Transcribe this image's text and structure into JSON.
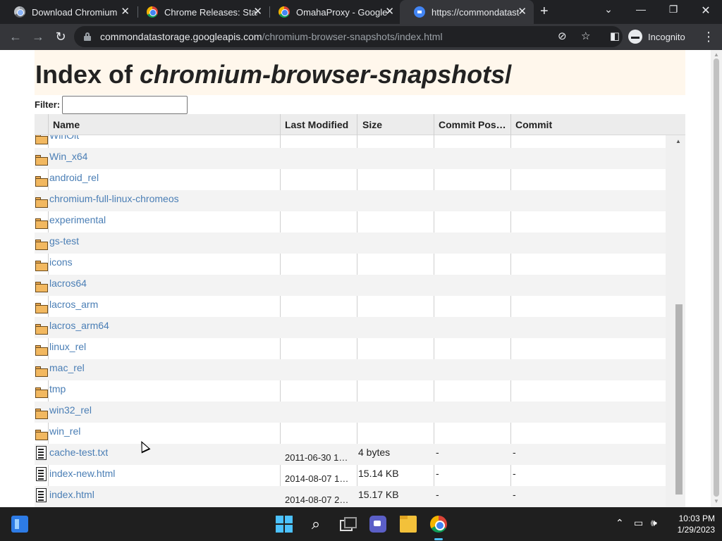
{
  "tabs": [
    {
      "title": "Download Chromium",
      "favicon": "chrome-gray-icon",
      "active": false
    },
    {
      "title": "Chrome Releases: Stabl",
      "favicon": "chrome-icon",
      "active": false
    },
    {
      "title": "OmahaProxy - Google",
      "favicon": "chrome-icon",
      "active": false
    },
    {
      "title": "https://commondatast",
      "favicon": "document-icon",
      "active": true
    }
  ],
  "tab_close_glyph": "✕",
  "new_tab_glyph": "+",
  "window_controls": {
    "dropdown": "⌄",
    "minimize": "—",
    "restore": "❐",
    "close": "✕"
  },
  "omnibox": {
    "host": "commondatastorage.googleapis.com",
    "path": "/chromium-browser-snapshots/index.html"
  },
  "profile": {
    "label": "Incognito"
  },
  "page": {
    "title_prefix": "Index of ",
    "title_path": "chromium-browser-snapshots",
    "title_suffix": "/",
    "filter_label": "Filter:",
    "filter_value": ""
  },
  "table": {
    "columns": [
      "Name",
      "Last Modified",
      "Size",
      "Commit Pos…",
      "Commit"
    ],
    "partial_top_row": "WinOit",
    "rows": [
      {
        "type": "folder",
        "name": "Win_x64",
        "modified": "",
        "size": "",
        "pos": "",
        "commit": ""
      },
      {
        "type": "folder",
        "name": "android_rel",
        "modified": "",
        "size": "",
        "pos": "",
        "commit": ""
      },
      {
        "type": "folder",
        "name": "chromium-full-linux-chromeos",
        "modified": "",
        "size": "",
        "pos": "",
        "commit": ""
      },
      {
        "type": "folder",
        "name": "experimental",
        "modified": "",
        "size": "",
        "pos": "",
        "commit": ""
      },
      {
        "type": "folder",
        "name": "gs-test",
        "modified": "",
        "size": "",
        "pos": "",
        "commit": ""
      },
      {
        "type": "folder",
        "name": "icons",
        "modified": "",
        "size": "",
        "pos": "",
        "commit": ""
      },
      {
        "type": "folder",
        "name": "lacros64",
        "modified": "",
        "size": "",
        "pos": "",
        "commit": ""
      },
      {
        "type": "folder",
        "name": "lacros_arm",
        "modified": "",
        "size": "",
        "pos": "",
        "commit": ""
      },
      {
        "type": "folder",
        "name": "lacros_arm64",
        "modified": "",
        "size": "",
        "pos": "",
        "commit": ""
      },
      {
        "type": "folder",
        "name": "linux_rel",
        "modified": "",
        "size": "",
        "pos": "",
        "commit": ""
      },
      {
        "type": "folder",
        "name": "mac_rel",
        "modified": "",
        "size": "",
        "pos": "",
        "commit": ""
      },
      {
        "type": "folder",
        "name": "tmp",
        "modified": "",
        "size": "",
        "pos": "",
        "commit": ""
      },
      {
        "type": "folder",
        "name": "win32_rel",
        "modified": "",
        "size": "",
        "pos": "",
        "commit": ""
      },
      {
        "type": "folder",
        "name": "win_rel",
        "modified": "",
        "size": "",
        "pos": "",
        "commit": ""
      },
      {
        "type": "file",
        "name": "cache-test.txt",
        "modified": "2011-06-30 1…",
        "size": "4 bytes",
        "pos": "-",
        "commit": "-"
      },
      {
        "type": "file",
        "name": "index-new.html",
        "modified": "2014-08-07 1…",
        "size": "15.14 KB",
        "pos": "-",
        "commit": "-"
      },
      {
        "type": "file",
        "name": "index.html",
        "modified": "2014-08-07 2…",
        "size": "15.17 KB",
        "pos": "-",
        "commit": "-"
      }
    ]
  },
  "taskbar": {
    "apps": [
      "widgets-icon",
      "windows-start-icon",
      "search-icon",
      "task-view-icon",
      "teams-chat-icon",
      "file-explorer-icon",
      "chrome-icon"
    ],
    "time": "10:03 PM",
    "date": "1/29/2023"
  },
  "colors": {
    "link": "#4a7eb5",
    "header_band": "#fff7ec",
    "chrome_frame": "#202124",
    "toolbar": "#35363a"
  }
}
